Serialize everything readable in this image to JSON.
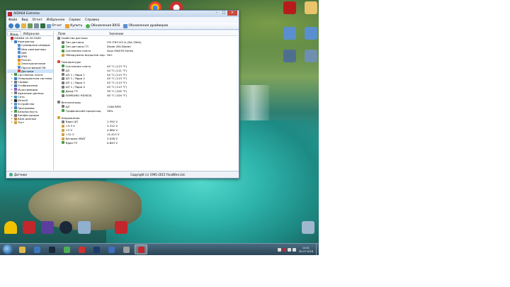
{
  "colors": {
    "accent": "#3c7fc1",
    "selection": "#cde3fb",
    "close": "#c94a3b",
    "aida_red": "#c1272d"
  },
  "window": {
    "title": "AIDA64 Extreme",
    "menu": [
      "Файл",
      "Вид",
      "Отчет",
      "Избранное",
      "Сервис",
      "Справка"
    ],
    "toolbar": {
      "report": "Отчет",
      "buy": "Купить",
      "bios_update": "Обновления BIOS",
      "driver_update": "Обновления драйверов"
    },
    "left_tabs": [
      "Меню",
      "Избранное"
    ],
    "tree": [
      {
        "label": "AIDA64 v5.20.3400",
        "level": 0,
        "icon": "#c1272d",
        "expander": ""
      },
      {
        "label": "Компьютер",
        "level": 1,
        "icon": "#3f7fbf",
        "expander": "-"
      },
      {
        "label": "Суммарная информ.",
        "level": 2,
        "icon": "#5b8fd0",
        "expander": ""
      },
      {
        "label": "Имя компьютера",
        "level": 2,
        "icon": "#5b8fd0",
        "expander": ""
      },
      {
        "label": "DMI",
        "level": 2,
        "icon": "#5b8fd0",
        "expander": ""
      },
      {
        "label": "IPMI",
        "level": 2,
        "icon": "#5b8fd0",
        "expander": ""
      },
      {
        "label": "Разгон",
        "level": 2,
        "icon": "#e08a2a",
        "expander": ""
      },
      {
        "label": "Электропитание",
        "level": 2,
        "icon": "#e2c23a",
        "expander": ""
      },
      {
        "label": "Портативный ПК",
        "level": 2,
        "icon": "#5b8fd0",
        "expander": ""
      },
      {
        "label": "Датчики",
        "level": 2,
        "icon": "#d24b3a",
        "expander": "",
        "selected": true
      },
      {
        "label": "Системная плата",
        "level": 1,
        "icon": "#4b9a4b",
        "expander": "+"
      },
      {
        "label": "Операционная система",
        "level": 1,
        "icon": "#3f7fbf",
        "expander": "+"
      },
      {
        "label": "Сервер",
        "level": 1,
        "icon": "#7a7a7a",
        "expander": "+"
      },
      {
        "label": "Отображение",
        "level": 1,
        "icon": "#3f7fbf",
        "expander": "+"
      },
      {
        "label": "Мультимедиа",
        "level": 1,
        "icon": "#8a5bbf",
        "expander": "+"
      },
      {
        "label": "Хранение данных",
        "level": 1,
        "icon": "#7a7a7a",
        "expander": "+"
      },
      {
        "label": "Сеть",
        "level": 1,
        "icon": "#3f9fbf",
        "expander": "+"
      },
      {
        "label": "DirectX",
        "level": 1,
        "icon": "#2f2f2f",
        "expander": "+"
      },
      {
        "label": "Устройства",
        "level": 1,
        "icon": "#5b8fd0",
        "expander": "+"
      },
      {
        "label": "Программы",
        "level": 1,
        "icon": "#3f7fbf",
        "expander": "+"
      },
      {
        "label": "Безопасность",
        "level": 1,
        "icon": "#4b9a4b",
        "expander": "+"
      },
      {
        "label": "Конфигурация",
        "level": 1,
        "icon": "#7a7a7a",
        "expander": "+"
      },
      {
        "label": "База данных",
        "level": 1,
        "icon": "#bf8a3f",
        "expander": "+"
      },
      {
        "label": "Тест",
        "level": 1,
        "icon": "#d2a03a",
        "expander": "+"
      }
    ],
    "columns": {
      "field": "Поле",
      "value": "Значение"
    },
    "rows": [
      {
        "type": "section",
        "field": "Свойства датчика",
        "value": "",
        "icon": "#7a7a7a"
      },
      {
        "type": "row",
        "field": "Тип датчика",
        "value": "ITE IT8712F-A (ISA 290h)",
        "icon": "#7a7a7a"
      },
      {
        "type": "row",
        "field": "Тип датчика ГП",
        "value": "Diode (NV-Diode)",
        "icon": "#4b9a4b"
      },
      {
        "type": "row",
        "field": "Системная плата",
        "value": "Asus M4A78 Series",
        "icon": "#4b9a4b"
      },
      {
        "type": "row",
        "field": "Обнаружено вскрытие кор...",
        "value": "Нет",
        "icon": "#d2a03a"
      },
      {
        "type": "gap"
      },
      {
        "type": "section",
        "field": "Температуры",
        "value": "",
        "icon": "#d24b3a"
      },
      {
        "type": "row",
        "field": "Системная плата",
        "value": "45 °C  (113 °F)",
        "icon": "#4b9a4b"
      },
      {
        "type": "row",
        "field": "ЦП",
        "value": "44 °C  (111 °F)",
        "icon": "#7a7a7a"
      },
      {
        "type": "row",
        "field": "ЦП 1 / Ядро 1",
        "value": "45 °C  (113 °F)",
        "icon": "#7a7a7a"
      },
      {
        "type": "row",
        "field": "ЦП 1 / Ядро 2",
        "value": "45 °C  (113 °F)",
        "icon": "#7a7a7a"
      },
      {
        "type": "row",
        "field": "ЦП 1 / Ядро 3",
        "value": "45 °C  (113 °F)",
        "icon": "#7a7a7a"
      },
      {
        "type": "row",
        "field": "ЦП 1 / Ядро 4",
        "value": "45 °C  (113 °F)",
        "icon": "#7a7a7a"
      },
      {
        "type": "row",
        "field": "Диод ГП",
        "value": "39 °C  (102 °F)",
        "icon": "#4b9a4b"
      },
      {
        "type": "row",
        "field": "SAMSUNG HD502IJ",
        "value": "40 °C  (104 °F)",
        "icon": "#7a7a7a"
      },
      {
        "type": "gap"
      },
      {
        "type": "section",
        "field": "Вентиляторы",
        "value": "",
        "icon": "#7a7a7a"
      },
      {
        "type": "row",
        "field": "ЦП",
        "value": "1346 RPM",
        "icon": "#7a7a7a"
      },
      {
        "type": "row",
        "field": "Графический процессор",
        "value": "38%",
        "icon": "#4b9a4b"
      },
      {
        "type": "gap"
      },
      {
        "type": "section",
        "field": "Напряжения",
        "value": "",
        "icon": "#d2a03a"
      },
      {
        "type": "row",
        "field": "Ядро ЦП",
        "value": "1.392 V",
        "icon": "#7a7a7a"
      },
      {
        "type": "row",
        "field": "+3.3 V",
        "value": "3.312 V",
        "icon": "#d2a03a"
      },
      {
        "type": "row",
        "field": "+5 V",
        "value": "4.960 V",
        "icon": "#d2a03a"
      },
      {
        "type": "row",
        "field": "+12 V",
        "value": "11.413 V",
        "icon": "#d2a03a"
      },
      {
        "type": "row",
        "field": "Батарея VBAT",
        "value": "3.038 V",
        "icon": "#d2a03a"
      },
      {
        "type": "row",
        "field": "Ядро ГП",
        "value": "0.843 V",
        "icon": "#4b9a4b"
      }
    ],
    "status_left": "Датчики",
    "status_center": "Copyright (c) 1995-2015 FinalWire Ltd."
  },
  "taskbar": {
    "clock_time": "14:41",
    "clock_date": "30.07.2016",
    "apps": [
      {
        "name": "explorer",
        "color": "#e0b84a"
      },
      {
        "name": "media",
        "color": "#3a78c2"
      },
      {
        "name": "steam",
        "color": "#1b2838"
      },
      {
        "name": "chrome",
        "color": "#4caf50"
      },
      {
        "name": "opera",
        "color": "#d32f2f"
      },
      {
        "name": "photoshop",
        "color": "#1d3b6b"
      },
      {
        "name": "app-blue",
        "color": "#3f6fbf"
      },
      {
        "name": "app-gray",
        "color": "#a0a0a0"
      },
      {
        "name": "aida64",
        "color": "#c1272d",
        "active": true
      }
    ]
  }
}
